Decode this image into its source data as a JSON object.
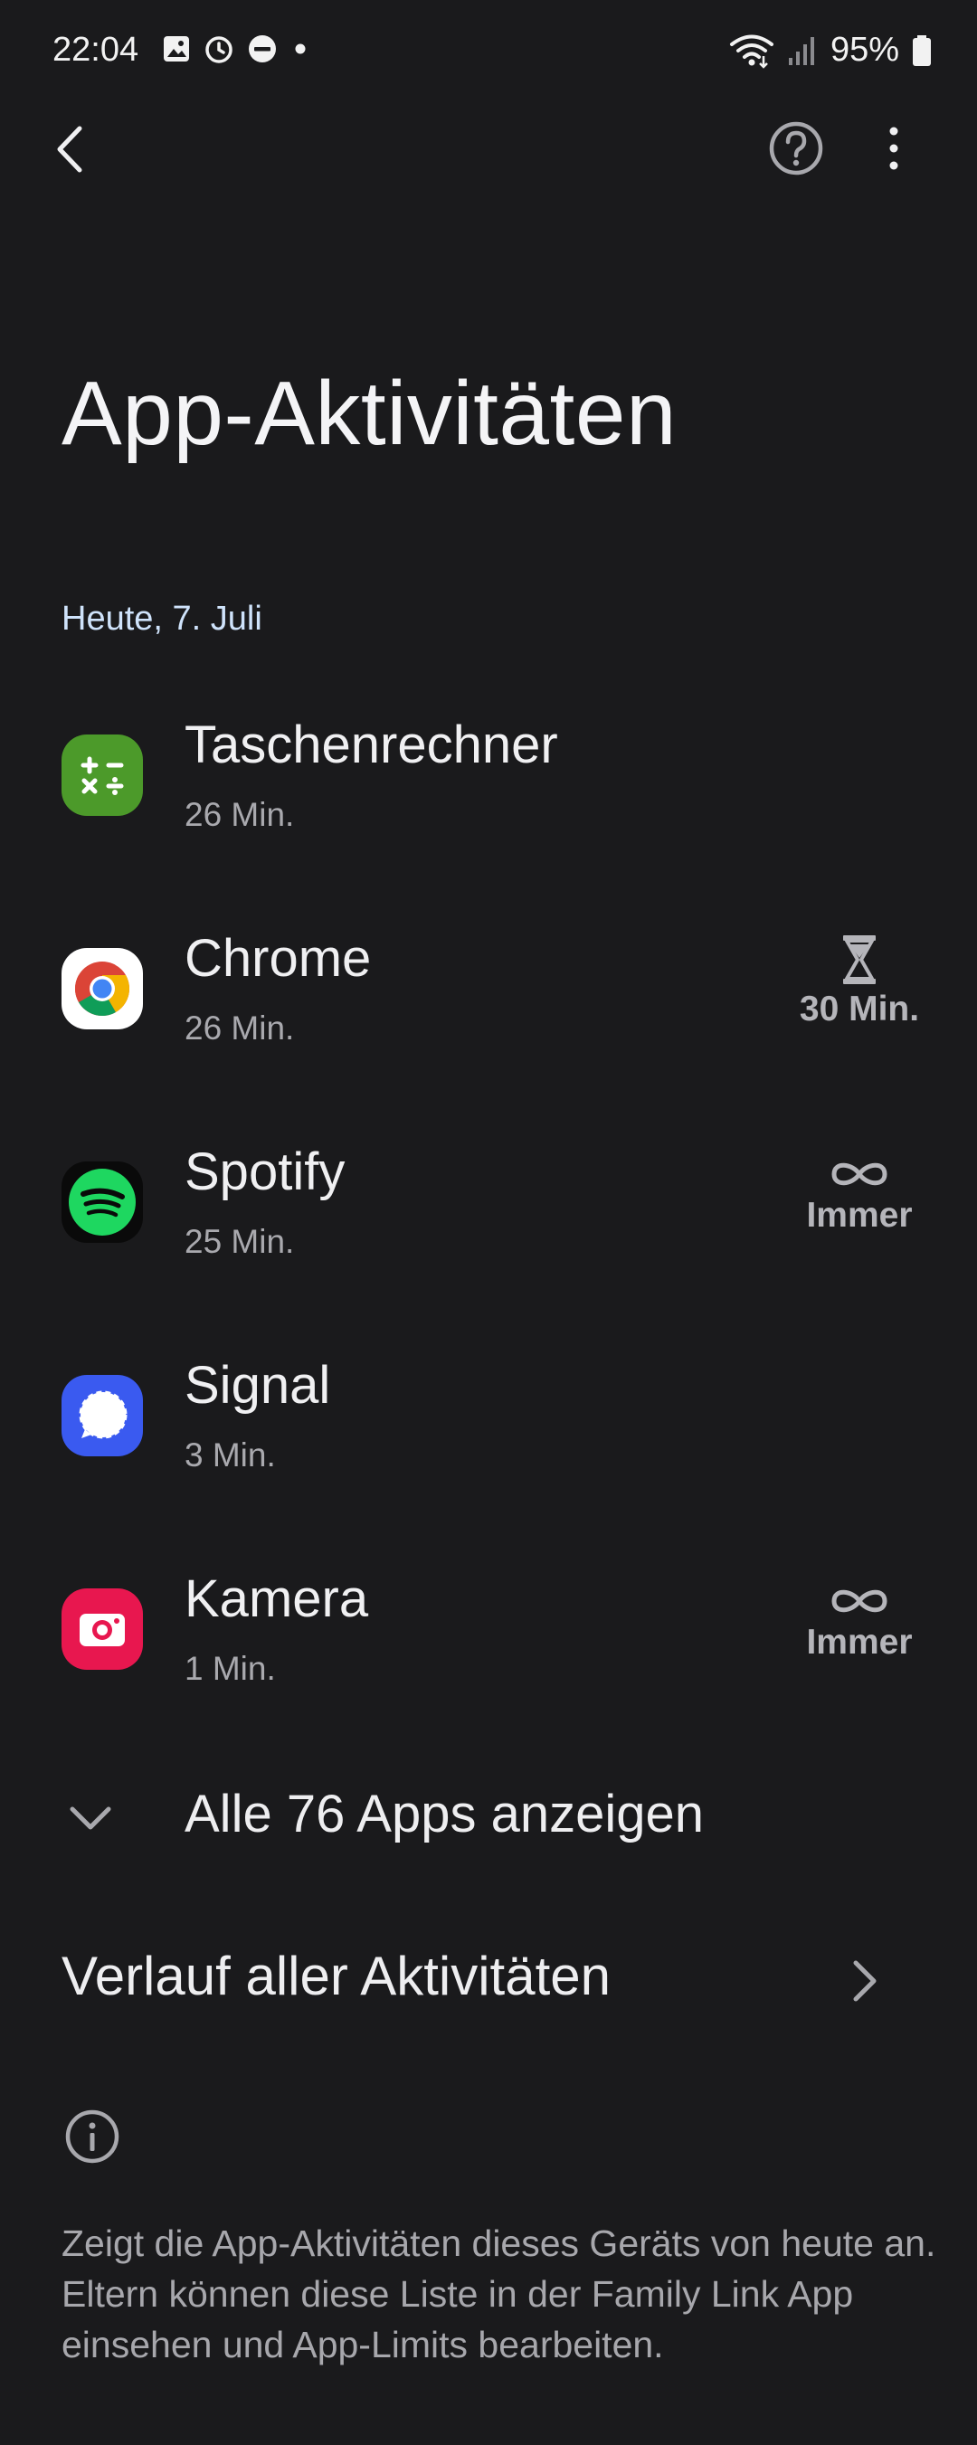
{
  "status_bar": {
    "time": "22:04",
    "battery": "95%"
  },
  "icons": {
    "back": "back-arrow-icon",
    "help": "help-circle-icon",
    "more": "more-vert-icon"
  },
  "page": {
    "title": "App-Aktivitäten",
    "date_header": "Heute, 7. Juli"
  },
  "apps": [
    {
      "name": "Taschenrechner",
      "time": "26 Min.",
      "icon": "calculator-icon",
      "color": "#4c9a2a",
      "limit": ""
    },
    {
      "name": "Chrome",
      "time": "26 Min.",
      "icon": "chrome-icon",
      "color": "#ffffff",
      "limit": "30 Min.",
      "limit_icon": "hourglass-icon"
    },
    {
      "name": "Spotify",
      "time": "25 Min.",
      "icon": "spotify-icon",
      "color": "#1ed760",
      "limit": "Immer",
      "limit_icon": "infinity-icon"
    },
    {
      "name": "Signal",
      "time": "3 Min.",
      "icon": "signal-icon",
      "color": "#3a76f0",
      "limit": ""
    },
    {
      "name": "Kamera",
      "time": "1 Min.",
      "icon": "camera-icon",
      "color": "#e8174f",
      "limit": "Immer",
      "limit_icon": "infinity-icon"
    }
  ],
  "show_all": {
    "label": "Alle 76 Apps anzeigen"
  },
  "history": {
    "label": "Verlauf aller Aktivitäten"
  },
  "info": {
    "text": "Zeigt die App-Aktivitäten dieses Geräts von heute an. Eltern können diese Liste in der Family Link App einsehen und App-Limits bearbeiten."
  }
}
